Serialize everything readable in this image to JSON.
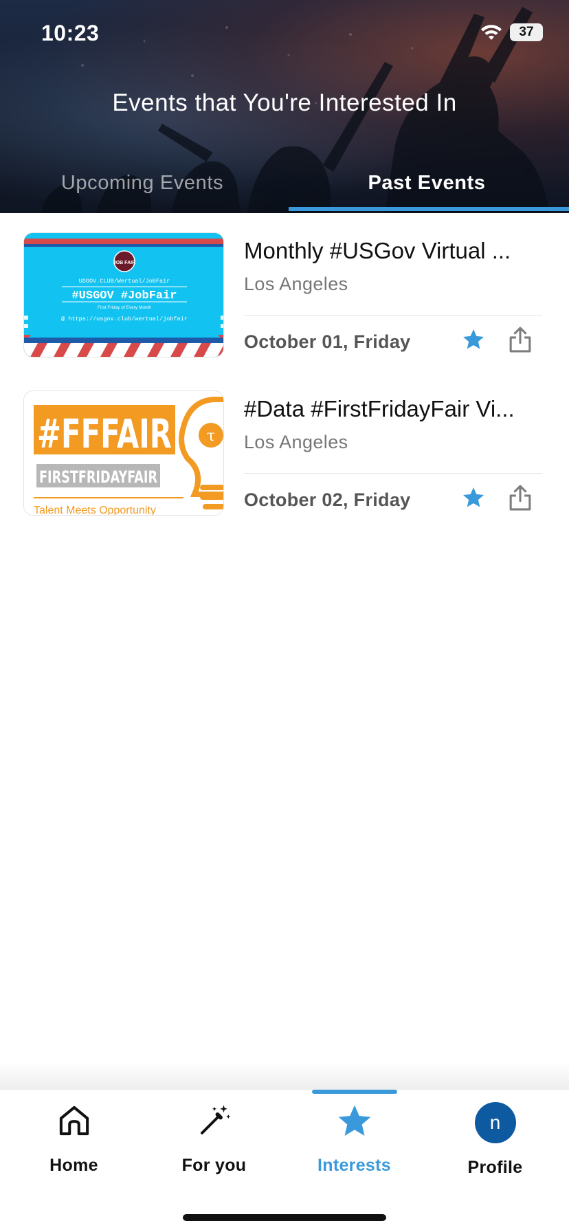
{
  "status_bar": {
    "time": "10:23",
    "battery": "37"
  },
  "header": {
    "title": "Events that You're Interested In",
    "tabs": [
      {
        "label": "Upcoming Events",
        "selected": false
      },
      {
        "label": "Past Events",
        "selected": true
      }
    ]
  },
  "events": [
    {
      "title": "Monthly #USGov Virtual ...",
      "location": "Los Angeles",
      "date": "October 01, Friday",
      "starred": true,
      "image": {
        "badge": "JOB FAIR",
        "line1": "USGOV.CLUB/Wertual/JobFair",
        "headline": "#USGOV #JobFair",
        "tagline": "First Friday of Every Month",
        "url": "@ https://usgov.club/wertual/jobfair"
      }
    },
    {
      "title": "#Data #FirstFridayFair Vi...",
      "location": "Los Angeles",
      "date": "October 02, Friday",
      "starred": true,
      "image": {
        "headline": "#FFFAIR",
        "subhead": "FIRSTFRIDAYFAIR",
        "tagline": "Talent Meets Opportunity",
        "logo_letter": "τ"
      }
    }
  ],
  "bottom_nav": {
    "items": [
      {
        "label": "Home",
        "icon": "home-icon",
        "active": false
      },
      {
        "label": "For you",
        "icon": "magic-wand-icon",
        "active": false
      },
      {
        "label": "Interests",
        "icon": "star-icon",
        "active": true
      },
      {
        "label": "Profile",
        "icon": "avatar",
        "active": false
      }
    ],
    "avatar_letter": "n"
  },
  "colors": {
    "accent": "#3a99db",
    "avatar": "#0d5aa0",
    "card1_bg": "#12c2f0",
    "card2_orange": "#f29a22"
  }
}
